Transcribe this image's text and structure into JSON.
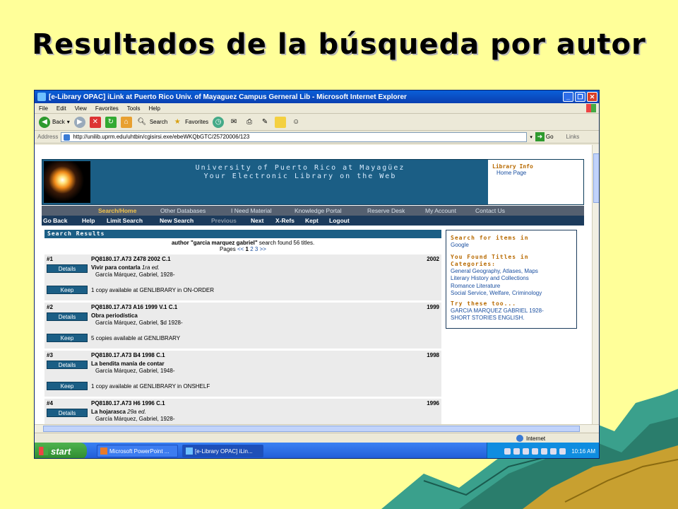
{
  "slide": {
    "title": "Resultados  de la búsqueda por autor"
  },
  "window": {
    "title": "[e-Library OPAC] iLink at Puerto Rico Univ. of Mayaguez Campus Gerneral Lib - Microsoft Internet Explorer",
    "menu": [
      "File",
      "Edit",
      "View",
      "Favorites",
      "Tools",
      "Help"
    ],
    "toolbar": {
      "back": "Back",
      "search": "Search",
      "favorites": "Favorites"
    },
    "address_label": "Address",
    "url": "http://unilib.uprm.edu/uhtbin/cgisirsi.exe/ebeWKQbGTC/25720006/123",
    "go": "Go",
    "links": "Links"
  },
  "library": {
    "univ_line1": "University of Puerto Rico at Mayagüez",
    "univ_line2": "Your Electronic Library on the Web",
    "info_title": "Library Info",
    "info_link": "Home Page",
    "nav_top": [
      "Search/Home",
      "Other Databases",
      "I Need Material",
      "Knowledge Portal",
      "Reserve Desk",
      "My Account",
      "Contact Us"
    ],
    "nav_bottom": [
      "Go Back",
      "Help",
      "Limit Search",
      "New Search",
      "Previous",
      "Next",
      "X-Refs",
      "Kept",
      "Logout"
    ]
  },
  "results": {
    "header": "Search Results",
    "summary_query": "author \"garcia marquez gabriel\"",
    "summary_rest": " search found 56 titles.",
    "pages_label": "Pages",
    "pages_prev": "<<",
    "pages_current": "1",
    "pages_2": "2",
    "pages_3": "3",
    "pages_next": ">>",
    "details_label": "Details",
    "keep_label": "Keep",
    "records": [
      {
        "num": "#1",
        "call": "PQ8180.17.A73 Z478 2002 C.1",
        "year": "2002",
        "title": "Vivir para contarla",
        "edition": "1ra ed.",
        "author": "García Márquez, Gabriel, 1928-",
        "avail": "1 copy available at GENLIBRARY in ON-ORDER"
      },
      {
        "num": "#2",
        "call": "PQ8180.17.A73 A16 1999 V.1 C.1",
        "year": "1999",
        "title": "Obra periodística",
        "edition": "",
        "author": "García Márquez, Gabriel, $d 1928-",
        "avail": "5 copies available at GENLIBRARY"
      },
      {
        "num": "#3",
        "call": "PQ8180.17.A73 B4 1998 C.1",
        "year": "1998",
        "title": "La bendita manía de contar",
        "edition": "",
        "author": "García Márquez, Gabriel, 1948-",
        "avail": "1 copy available at GENLIBRARY in ONSHELF"
      },
      {
        "num": "#4",
        "call": "PQ8180.17.A73 H6 1996 C.1",
        "year": "1996",
        "title": "La hojarasca",
        "edition": "29a ed.",
        "author": "García Márquez, Gabriel, 1928-",
        "avail": ""
      }
    ]
  },
  "sidebar": {
    "search_title": "Search for items in",
    "search_link": "Google",
    "found_title_1": "You Found Titles in",
    "found_title_2": "Categories:",
    "categories": [
      "General Geography, Atlases, Maps",
      "Literary History and Collections",
      "Romance Literature",
      "Social Service, Welfare, Criminology"
    ],
    "try_title": "Try these too...",
    "try_links": [
      "GARCIA MARQUEZ GABRIEL 1928-",
      "SHORT STORIES ENGLISH."
    ]
  },
  "status": {
    "zone": "Internet"
  },
  "taskbar": {
    "start": "start",
    "tasks": [
      "Microsoft PowerPoint ...",
      "[e-Library OPAC] iLin..."
    ],
    "clock": "10:16 AM"
  },
  "colors": {
    "slide_bg": "#ffff99",
    "lib_blue": "#1b5e85",
    "accent_orange": "#b86a00",
    "link_blue": "#1a4fa0"
  }
}
